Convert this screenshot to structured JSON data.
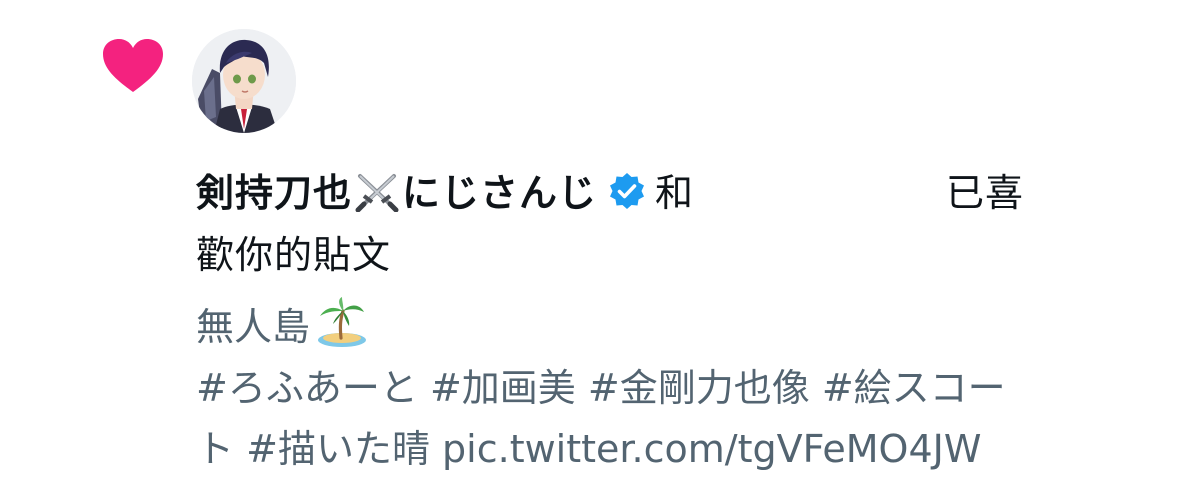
{
  "notification": {
    "type_icon": "heart-icon",
    "avatar_icon": "avatar",
    "user": {
      "display_name": "剣持刀也",
      "name_emoji": "crossed-swords-icon",
      "name_suffix": "にじさんじ",
      "verified_icon": "verified-badge-icon"
    },
    "and_text": "和",
    "action_text_line1": "已喜",
    "action_text_line2": "歡你的貼文",
    "post_preview": {
      "title": "無人島",
      "title_emoji": "desert-island-icon",
      "hashtags": [
        "#ろふあーと",
        "#加画美",
        "#金剛力也像",
        "#絵スコー",
        "ト",
        "#描いた晴"
      ],
      "media_link": "pic.twitter.com/tgVFeMO4JW"
    }
  },
  "colors": {
    "heart": "#f4227f",
    "verified": "#1d9bf0",
    "primary_text": "#0f1419",
    "secondary_text": "#536471"
  }
}
